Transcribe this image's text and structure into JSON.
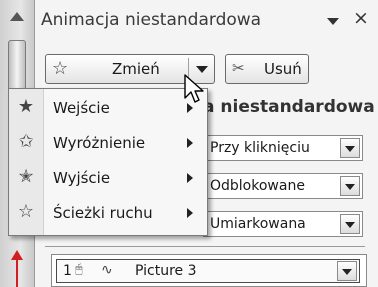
{
  "pane": {
    "title": "Animacja niestandardowa",
    "close_glyph": "×"
  },
  "toolbar": {
    "change_icon": "☆",
    "change_label": "Zmień",
    "remove_icon": "✂",
    "remove_label": "Usuń"
  },
  "modify": {
    "section_label": "a niestandardowa",
    "start_value": "Przy kliknięciu",
    "direction_value": "Odblokowane",
    "speed_value": "Umiarkowana"
  },
  "menu": {
    "items": [
      {
        "icon": "★",
        "label": "Wejście",
        "icon_name": "entrance-star-icon"
      },
      {
        "icon": "✩",
        "label": "Wyróżnienie",
        "icon_name": "emphasis-star-icon"
      },
      {
        "icon": "✭",
        "label": "Wyjście",
        "icon_name": "exit-star-icon"
      },
      {
        "icon": "☆",
        "label": "Ścieżki ruchu",
        "icon_name": "motion-path-star-icon"
      }
    ]
  },
  "animation_list": {
    "rows": [
      {
        "order": "1",
        "mouse_icon": "🖰",
        "path_icon": "∿",
        "name": "Picture 3"
      }
    ]
  },
  "colors": {
    "pane_bg": "#f4f4f4",
    "marker_red": "#d02020"
  }
}
